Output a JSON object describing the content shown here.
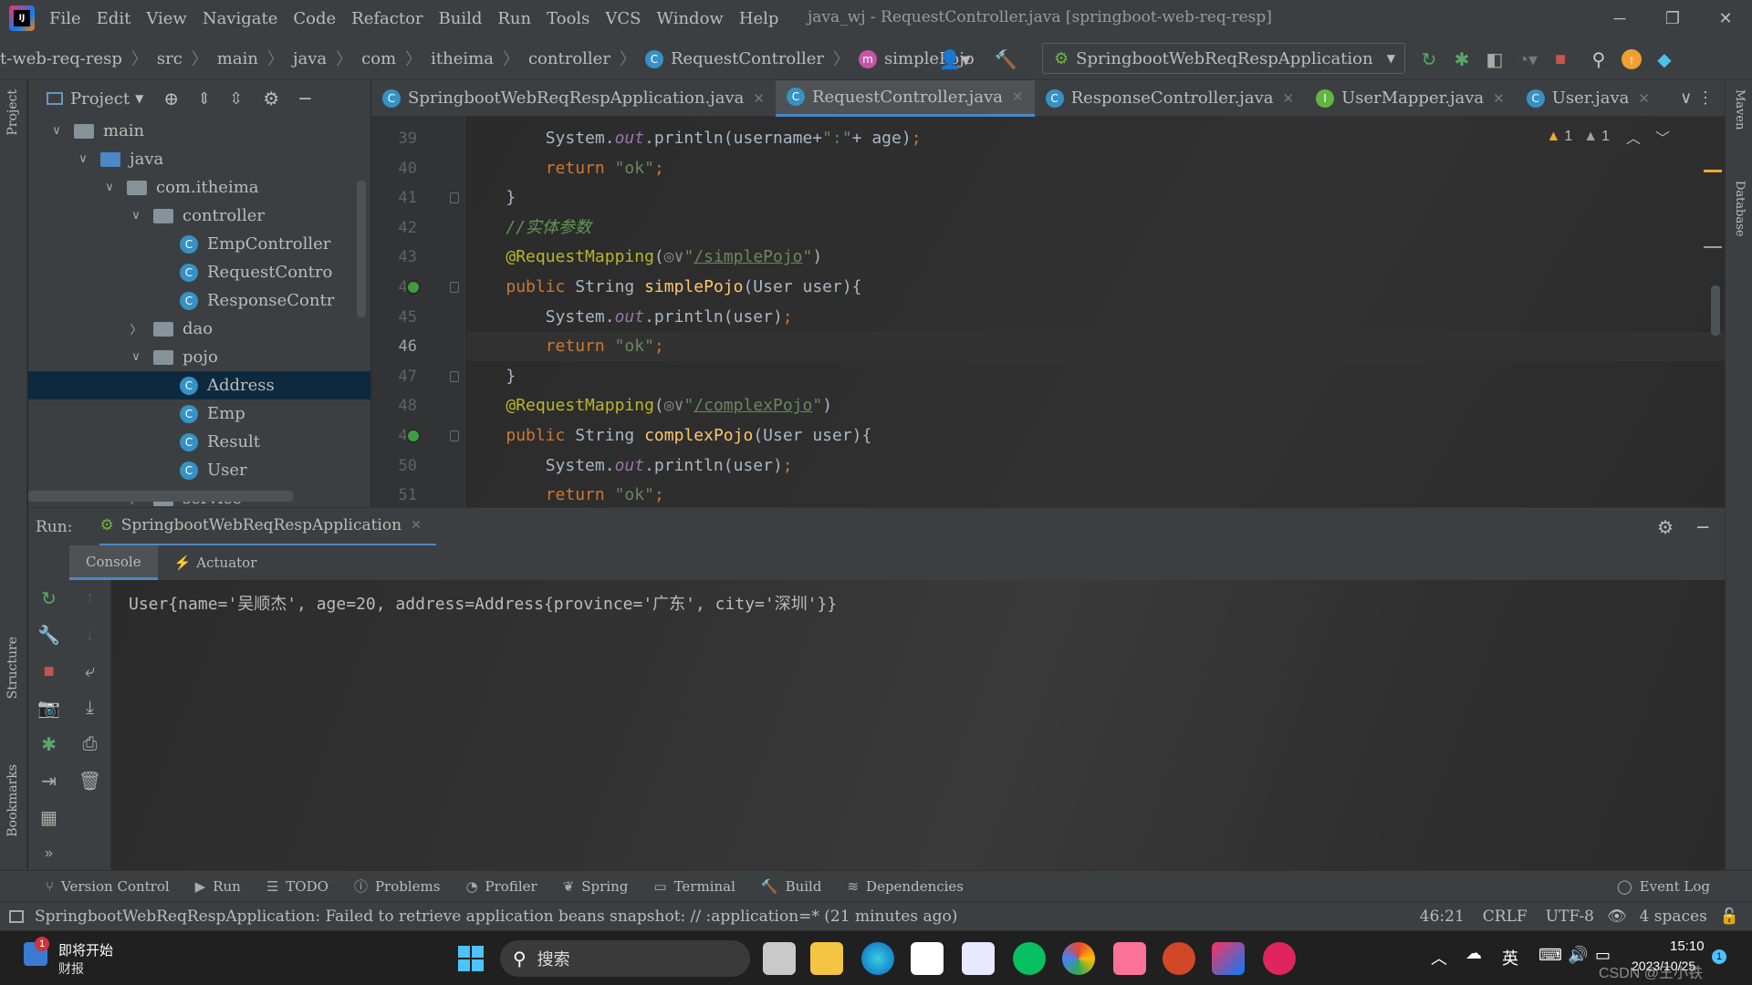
{
  "titlebar": {
    "logo_text": "IJ",
    "menu": [
      "File",
      "Edit",
      "View",
      "Navigate",
      "Code",
      "Refactor",
      "Build",
      "Run",
      "Tools",
      "VCS",
      "Window",
      "Help"
    ],
    "title": "java_wj - RequestController.java [springboot-web-req-resp]"
  },
  "navbar": {
    "breadcrumbs": [
      "t-web-req-resp",
      "src",
      "main",
      "java",
      "com",
      "itheima",
      "controller"
    ],
    "class_crumb": "RequestController",
    "method_crumb": "simplePojo",
    "run_config": "SpringbootWebReqRespApplication"
  },
  "project_panel": {
    "title": "Project",
    "tree": [
      {
        "label": "main",
        "depth": 0,
        "arrow": "v",
        "kind": "folder"
      },
      {
        "label": "java",
        "depth": 1,
        "arrow": "v",
        "kind": "folder-blue"
      },
      {
        "label": "com.itheima",
        "depth": 2,
        "arrow": "v",
        "kind": "folder"
      },
      {
        "label": "controller",
        "depth": 3,
        "arrow": "v",
        "kind": "folder"
      },
      {
        "label": "EmpController",
        "depth": 4,
        "arrow": "",
        "kind": "class"
      },
      {
        "label": "RequestContro",
        "depth": 4,
        "arrow": "",
        "kind": "class"
      },
      {
        "label": "ResponseContr",
        "depth": 4,
        "arrow": "",
        "kind": "class"
      },
      {
        "label": "dao",
        "depth": 3,
        "arrow": ">",
        "kind": "folder"
      },
      {
        "label": "pojo",
        "depth": 3,
        "arrow": "v",
        "kind": "folder"
      },
      {
        "label": "Address",
        "depth": 4,
        "arrow": "",
        "kind": "class",
        "selected": true
      },
      {
        "label": "Emp",
        "depth": 4,
        "arrow": "",
        "kind": "class"
      },
      {
        "label": "Result",
        "depth": 4,
        "arrow": "",
        "kind": "class"
      },
      {
        "label": "User",
        "depth": 4,
        "arrow": "",
        "kind": "class"
      },
      {
        "label": "service",
        "depth": 3,
        "arrow": ">",
        "kind": "folder"
      }
    ]
  },
  "editor_tabs": [
    {
      "label": "SpringbootWebReqRespApplication.java",
      "active": false
    },
    {
      "label": "RequestController.java",
      "active": true
    },
    {
      "label": "ResponseController.java",
      "active": false
    },
    {
      "label": "UserMapper.java",
      "active": false,
      "icon": "I"
    },
    {
      "label": "User.java",
      "active": false
    }
  ],
  "inspections": {
    "warnings": "1",
    "weak_warnings": "1"
  },
  "code_lines": [
    {
      "n": "39",
      "html": "        System.<span class='fld'>out</span>.println(username+<span class='str'>\":\"</span>+ age)<span class='kw'>;</span>"
    },
    {
      "n": "40",
      "html": "        <span class='kw'>return</span> <span class='str'>\"ok\"</span><span class='kw'>;</span>"
    },
    {
      "n": "41",
      "html": "    }"
    },
    {
      "n": "42",
      "html": "    <span class='cmt'>//实体参数</span>"
    },
    {
      "n": "43",
      "html": "    <span class='ann'>@RequestMapping</span>(<span style='color:#888'>◎∨</span><span class='str'>\"</span><span class='url'>/simplePojo</span><span class='str'>\"</span>)"
    },
    {
      "n": "44",
      "html": "    <span class='kw'>public</span> String <span class='fn'>simplePojo</span>(User user){"
    },
    {
      "n": "45",
      "html": "        System.<span class='fld'>out</span>.println(user)<span class='kw'>;</span>"
    },
    {
      "n": "46",
      "html": "        <span class='kw'>return</span> <span class='str'>\"ok\"</span><span class='kw'>;</span>",
      "current": true
    },
    {
      "n": "47",
      "html": "    }"
    },
    {
      "n": "48",
      "html": "    <span class='ann'>@RequestMapping</span>(<span style='color:#888'>◎∨</span><span class='str'>\"</span><span class='url'>/complexPojo</span><span class='str'>\"</span>)"
    },
    {
      "n": "49",
      "html": "    <span class='kw'>public</span> String <span class='fn'>complexPojo</span>(User user){"
    },
    {
      "n": "50",
      "html": "        System.<span class='fld'>out</span>.println(user)<span class='kw'>;</span>"
    },
    {
      "n": "51",
      "html": "        <span class='kw'>return</span> <span class='str'>\"ok\"</span><span class='kw'>;</span>"
    }
  ],
  "run_panel": {
    "label": "Run:",
    "config": "SpringbootWebReqRespApplication",
    "tabs": [
      "Console",
      "Actuator"
    ],
    "console_output": "User{name='吴顺杰', age=20, address=Address{province='广东', city='深圳'}}"
  },
  "left_strip": {
    "project": "Project",
    "structure": "Structure",
    "bookmarks": "Bookmarks"
  },
  "right_strip": {
    "maven": "Maven",
    "database": "Database"
  },
  "bottom_tools": [
    "Version Control",
    "Run",
    "TODO",
    "Problems",
    "Profiler",
    "Spring",
    "Terminal",
    "Build",
    "Dependencies"
  ],
  "event_log": "Event Log",
  "status": {
    "message": "SpringbootWebReqRespApplication: Failed to retrieve application beans snapshot: // :application=* (21 minutes ago)",
    "position": "46:21",
    "line_sep": "CRLF",
    "encoding": "UTF-8",
    "indent": "4 spaces"
  },
  "taskbar": {
    "news_title": "即将开始",
    "news_sub": "财报",
    "news_badge": "1",
    "search_placeholder": "搜索",
    "ime": "英",
    "time": "15:10",
    "date": "2023/10/25",
    "watermark": "CSDN @王小铁",
    "notify_badge": "1"
  }
}
